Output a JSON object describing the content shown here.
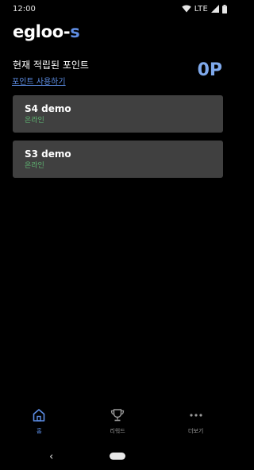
{
  "status_bar": {
    "time": "12:00",
    "network": "LTE",
    "icons": [
      "wifi-icon",
      "signal-icon",
      "battery-icon"
    ]
  },
  "logo": {
    "part1": "egloo-",
    "part2": "s"
  },
  "points": {
    "label": "현재 적립된 포인트",
    "use_link": "포인트 사용하기",
    "value": "0P"
  },
  "devices": [
    {
      "name": "S4 demo",
      "status": "온라인"
    },
    {
      "name": "S3 demo",
      "status": "온라인"
    }
  ],
  "bottom_nav": {
    "items": [
      {
        "label": "홈",
        "icon": "home-icon",
        "active": true
      },
      {
        "label": "리워드",
        "icon": "trophy-icon",
        "active": false
      },
      {
        "label": "더보기",
        "icon": "more-icon",
        "active": false
      }
    ]
  },
  "system_nav": {
    "back_glyph": "‹",
    "icons": [
      "back-icon",
      "home-pill-icon"
    ]
  },
  "colors": {
    "background": "#000000",
    "accent": "#5d8ee6",
    "points_value": "#7fa9ec",
    "card": "#404040",
    "online": "#5fb572"
  }
}
